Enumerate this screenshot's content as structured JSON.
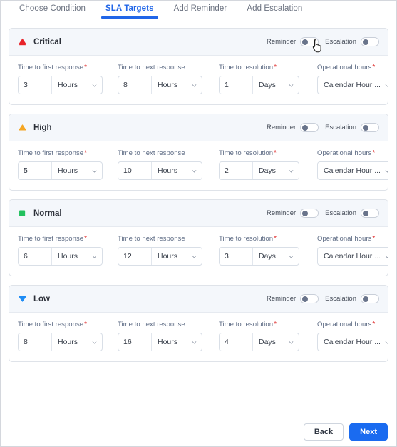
{
  "tabs": [
    {
      "label": "Choose Condition",
      "active": false
    },
    {
      "label": "SLA Targets",
      "active": true
    },
    {
      "label": "Add Reminder",
      "active": false
    },
    {
      "label": "Add Escalation",
      "active": false
    }
  ],
  "field_labels": {
    "first_response": "Time to first response",
    "next_response": "Time to next response",
    "resolution": "Time to resolution",
    "operational_hours": "Operational hours",
    "required_marker": "*"
  },
  "toggles": {
    "reminder_label": "Reminder",
    "escalation_label": "Escalation"
  },
  "sections": [
    {
      "priority": "Critical",
      "icon": "red-alert-triangle-icon",
      "color": "#e8242a",
      "reminder_on": false,
      "escalation_on": false,
      "first_response": {
        "value": "3",
        "unit": "Hours"
      },
      "next_response": {
        "value": "8",
        "unit": "Hours"
      },
      "resolution": {
        "value": "1",
        "unit": "Days"
      },
      "operational_hours": "Calendar Hour ..."
    },
    {
      "priority": "High",
      "icon": "orange-triangle-icon",
      "color": "#f5a623",
      "reminder_on": false,
      "escalation_on": false,
      "first_response": {
        "value": "5",
        "unit": "Hours"
      },
      "next_response": {
        "value": "10",
        "unit": "Hours"
      },
      "resolution": {
        "value": "2",
        "unit": "Days"
      },
      "operational_hours": "Calendar Hour ..."
    },
    {
      "priority": "Normal",
      "icon": "green-square-icon",
      "color": "#22c15e",
      "reminder_on": false,
      "escalation_on": false,
      "first_response": {
        "value": "6",
        "unit": "Hours"
      },
      "next_response": {
        "value": "12",
        "unit": "Hours"
      },
      "resolution": {
        "value": "3",
        "unit": "Days"
      },
      "operational_hours": "Calendar Hour ..."
    },
    {
      "priority": "Low",
      "icon": "blue-down-triangle-icon",
      "color": "#1f8df5",
      "reminder_on": false,
      "escalation_on": false,
      "first_response": {
        "value": "8",
        "unit": "Hours"
      },
      "next_response": {
        "value": "16",
        "unit": "Hours"
      },
      "resolution": {
        "value": "4",
        "unit": "Days"
      },
      "operational_hours": "Calendar Hour ..."
    }
  ],
  "footer": {
    "back_label": "Back",
    "next_label": "Next",
    "next_color": "#1a6bf0"
  },
  "cursor": {
    "type": "pointing-hand-cursor"
  }
}
